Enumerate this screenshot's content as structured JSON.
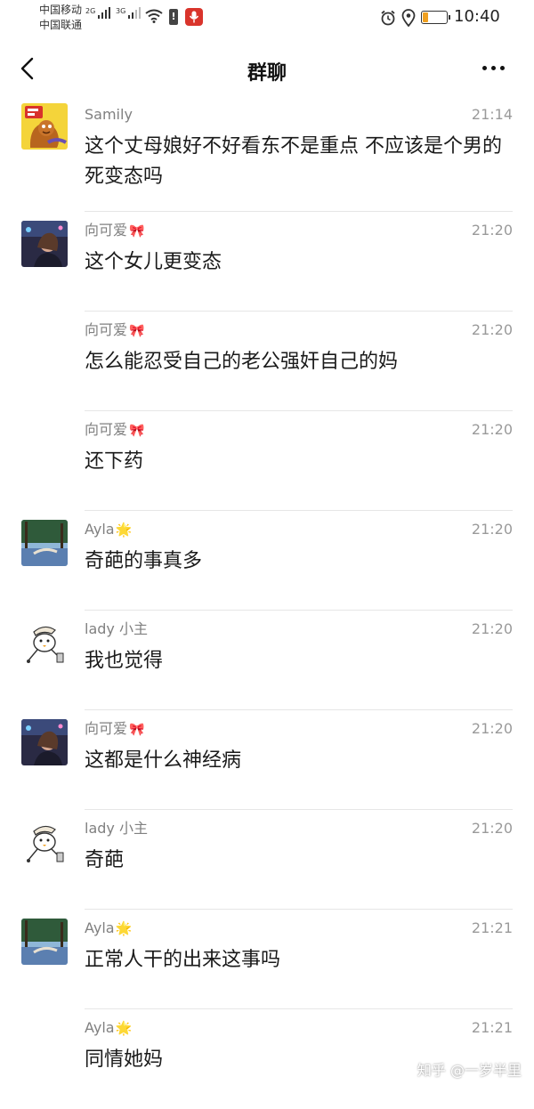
{
  "status_bar": {
    "carrier_1": "中国移动",
    "carrier_2": "中国联通",
    "network_1": "2G",
    "network_2": "3G",
    "time": "10:40"
  },
  "header": {
    "title": "群聊"
  },
  "messages": [
    {
      "sender": "Samily",
      "badge": "",
      "time": "21:14",
      "text": "这个丈母娘好不好看东不是重点 不应该是个男的死变态吗",
      "avatar": "cartoon-poster"
    },
    {
      "sender": "向可爱",
      "badge": "🎀",
      "time": "21:20",
      "text": "这个女儿更变态",
      "avatar": "photo-night"
    },
    {
      "sender": "向可爱",
      "badge": "🎀",
      "time": "21:20",
      "text": "怎么能忍受自己的老公强奸自己的妈",
      "avatar": ""
    },
    {
      "sender": "向可爱",
      "badge": "🎀",
      "time": "21:20",
      "text": "还下药",
      "avatar": ""
    },
    {
      "sender": "Ayla",
      "badge": "🌟",
      "time": "21:20",
      "text": "奇葩的事真多",
      "avatar": "photo-trees"
    },
    {
      "sender": "lady 小主",
      "badge": "",
      "time": "21:20",
      "text": "我也觉得",
      "avatar": "cartoon-duck"
    },
    {
      "sender": "向可爱",
      "badge": "🎀",
      "time": "21:20",
      "text": "这都是什么神经病",
      "avatar": "photo-night"
    },
    {
      "sender": "lady 小主",
      "badge": "",
      "time": "21:20",
      "text": "奇葩",
      "avatar": "cartoon-duck"
    },
    {
      "sender": "Ayla",
      "badge": "🌟",
      "time": "21:21",
      "text": "正常人干的出来这事吗",
      "avatar": "photo-trees"
    },
    {
      "sender": "Ayla",
      "badge": "🌟",
      "time": "21:21",
      "text": "同情她妈",
      "avatar": ""
    }
  ],
  "watermark": "知乎 @一岁半里",
  "colors": {
    "background": "#ffffff",
    "text": "#1a1a1a",
    "meta": "#9a9a9a",
    "divider": "#e6e6e6",
    "mic_badge": "#d9342b",
    "battery_fill": "#f0a020"
  }
}
